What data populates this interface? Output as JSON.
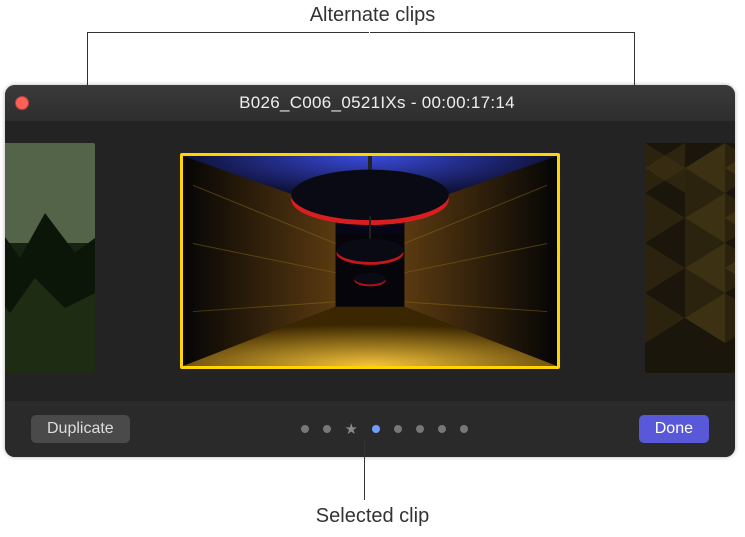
{
  "callouts": {
    "alternate": "Alternate clips",
    "selected": "Selected clip"
  },
  "titlebar": {
    "title": "B026_C006_0521IXs - 00:00:17:14"
  },
  "buttons": {
    "duplicate": "Duplicate",
    "done": "Done"
  },
  "pager": {
    "count": 8,
    "active_index": 3,
    "star_index": 2
  },
  "icons": {
    "close": "close-icon",
    "star": "★"
  },
  "colors": {
    "selected_border": "#ffd400",
    "done_button": "#5858d8",
    "active_dot": "#6fa0ff"
  }
}
